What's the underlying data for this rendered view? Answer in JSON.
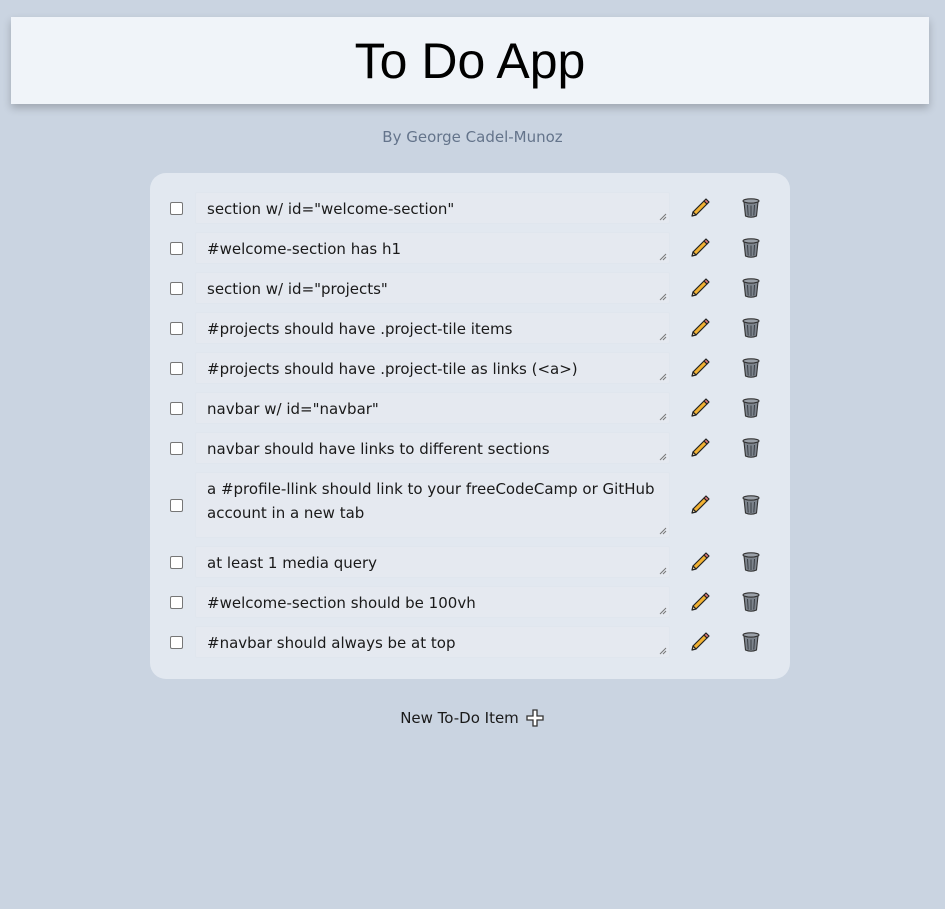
{
  "app": {
    "title": "To Do App",
    "byline": "By George Cadel-Munoz"
  },
  "todos": [
    {
      "text": "section w/ id=\"welcome-section\"",
      "checked": false
    },
    {
      "text": "#welcome-section has h1",
      "checked": false
    },
    {
      "text": "section w/ id=\"projects\"",
      "checked": false
    },
    {
      "text": "#projects should have .project-tile items",
      "checked": false
    },
    {
      "text": "#projects should have .project-tile as links (<a>)",
      "checked": false
    },
    {
      "text": "navbar w/ id=\"navbar\"",
      "checked": false
    },
    {
      "text": "navbar should have links to different sections",
      "checked": false
    },
    {
      "text": "a #profile-llink should link to your freeCodeCamp or GitHub account in a new tab",
      "checked": false
    },
    {
      "text": "at least 1 media query",
      "checked": false
    },
    {
      "text": "#welcome-section should be 100vh",
      "checked": false
    },
    {
      "text": "#navbar should always be at top",
      "checked": false
    }
  ],
  "new_item": {
    "label": "New To-Do Item"
  },
  "icons": {
    "edit": "pencil-icon",
    "delete": "trash-icon",
    "add": "plus-icon"
  },
  "colors": {
    "background": "#cad4e1",
    "header_bg": "#f0f4f9",
    "panel_bg": "#e2e8f0",
    "byline": "#64748b",
    "pencil": "#f2b233"
  }
}
